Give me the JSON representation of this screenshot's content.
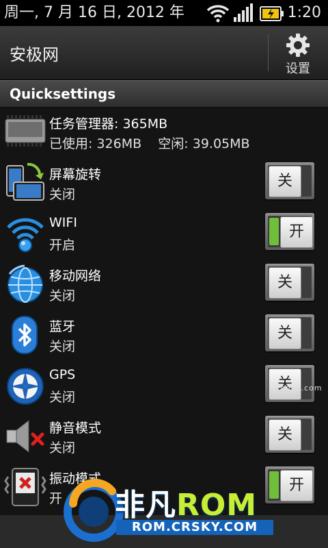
{
  "status_bar": {
    "date": "周一, 7 月 16 日, 2012 年",
    "time": "1:20"
  },
  "header": {
    "title": "安极网",
    "settings_label": "设置"
  },
  "section": {
    "title": "Quicksettings"
  },
  "task_manager": {
    "title": "任务管理器: 365MB",
    "usage": "已使用: 326MB    空闲: 39.05MB"
  },
  "settings": [
    {
      "label": "屏幕旋转",
      "state": "关闭",
      "toggle": "关",
      "on": false
    },
    {
      "label": "WIFI",
      "state": "开启",
      "toggle": "开",
      "on": true
    },
    {
      "label": "移动网络",
      "state": "关闭",
      "toggle": "关",
      "on": false
    },
    {
      "label": "蓝牙",
      "state": "关闭",
      "toggle": "关",
      "on": false
    },
    {
      "label": "GPS",
      "state": "关闭",
      "toggle": "关",
      "on": false
    },
    {
      "label": "静音模式",
      "state": "关闭",
      "toggle": "关",
      "on": false
    },
    {
      "label": "振动模式",
      "state": "开",
      "toggle": "开",
      "on": true
    }
  ],
  "watermark": "romzj.com",
  "logo": {
    "brand": "非凡",
    "brand_rom": "ROM",
    "url": "ROM.CRSKY.COM"
  }
}
